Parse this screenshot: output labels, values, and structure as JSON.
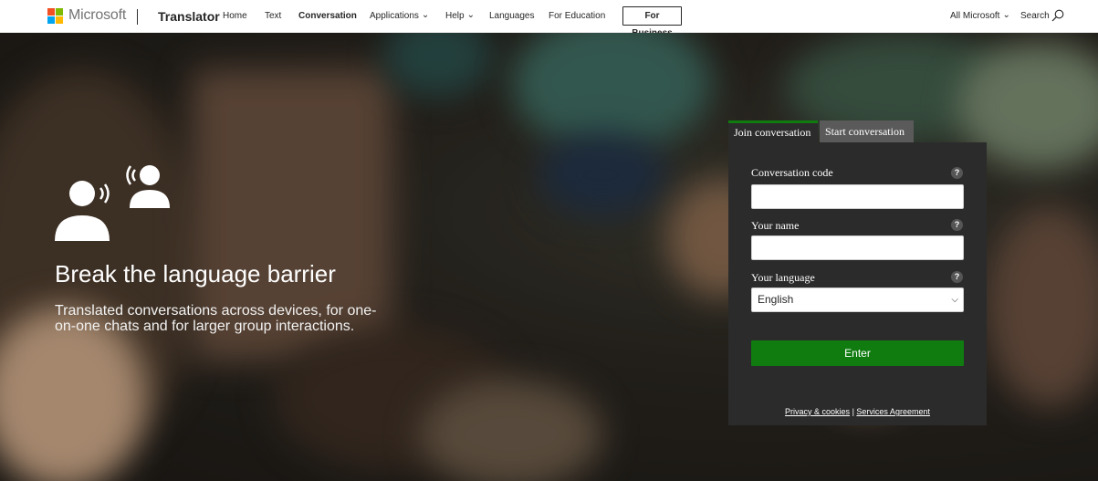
{
  "header": {
    "ms_wordmark": "Microsoft",
    "brand": "Translator",
    "nav": [
      {
        "label": "Home"
      },
      {
        "label": "Text"
      },
      {
        "label": "Conversation"
      },
      {
        "label": "Applications"
      },
      {
        "label": "Help"
      },
      {
        "label": "Languages"
      },
      {
        "label": "For Education"
      }
    ],
    "business_button": "For Business",
    "all_microsoft": "All Microsoft",
    "search_label": "Search"
  },
  "hero": {
    "title": "Break the language barrier",
    "subtitle": "Translated conversations across devices, for one-on-one chats and for larger group interactions."
  },
  "panel": {
    "tabs": [
      {
        "label": "Join conversation",
        "active": true
      },
      {
        "label": "Start conversation",
        "active": false
      }
    ],
    "fields": {
      "code_label": "Conversation code",
      "code_value": "",
      "name_label": "Your name",
      "name_value": "",
      "language_label": "Your language",
      "language_value": "English",
      "help_glyph": "?"
    },
    "enter_label": "Enter",
    "privacy_link": "Privacy & cookies",
    "separator": "|",
    "agreement_link": "Services Agreement"
  },
  "colors": {
    "accent_green": "#107c10",
    "panel_bg": "#2b2b2b"
  }
}
